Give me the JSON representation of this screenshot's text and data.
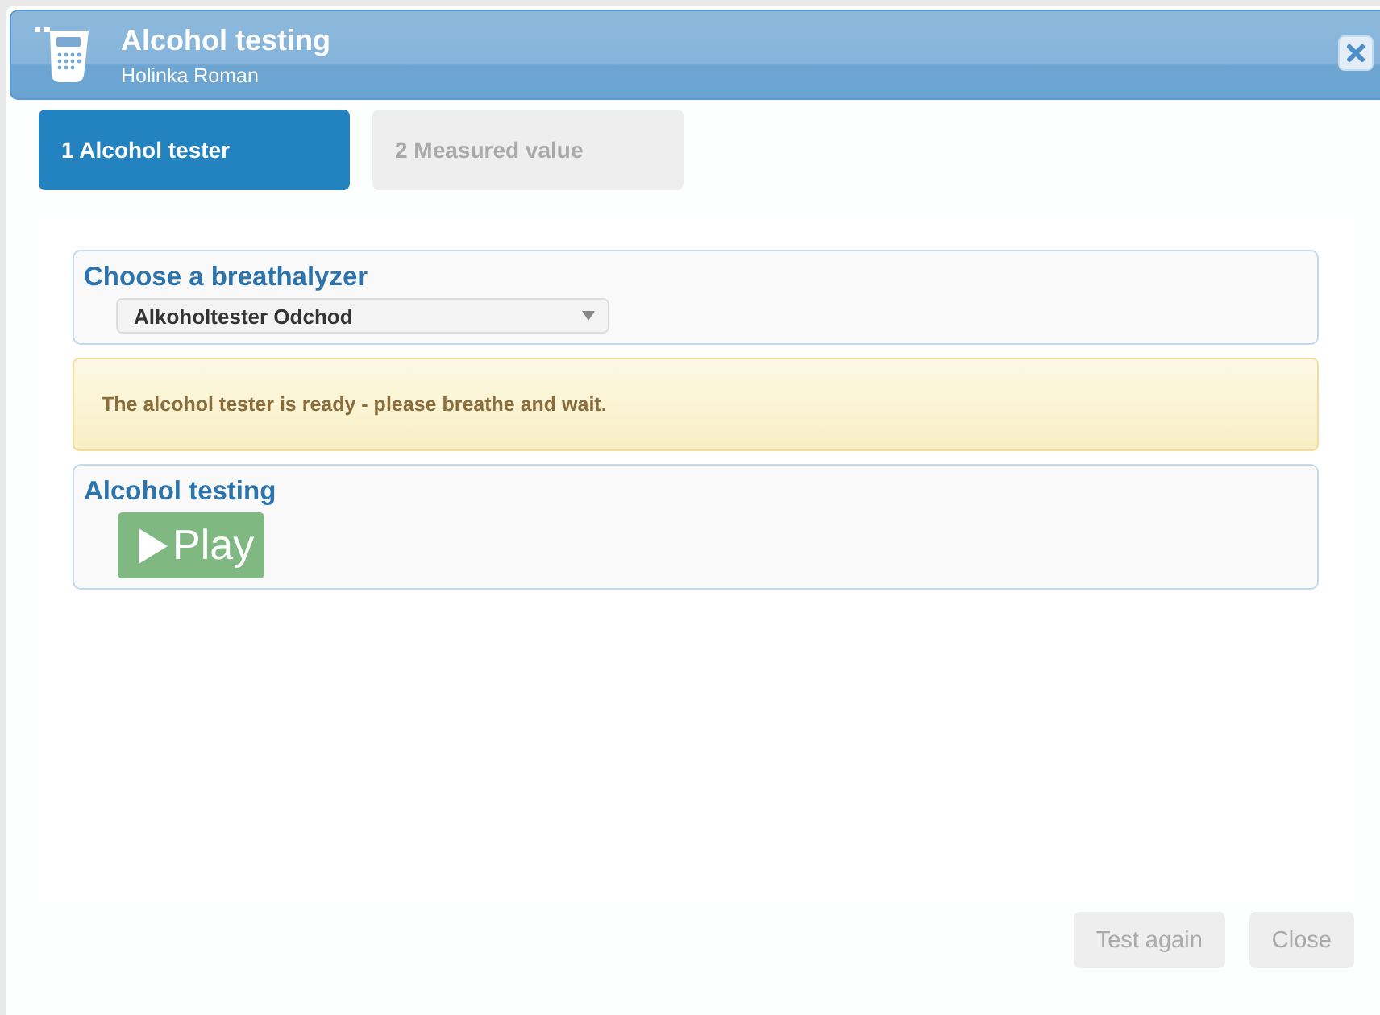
{
  "dialog": {
    "title": "Alcohol testing",
    "subtitle": "Holinka Roman"
  },
  "steps": [
    {
      "label": "1 Alcohol tester",
      "selected": true
    },
    {
      "label": "2 Measured value",
      "selected": false
    }
  ],
  "breathalyzer": {
    "heading": "Choose a breathalyzer",
    "value": "Alkoholtester Odchod"
  },
  "alert": {
    "text": "The alcohol tester is ready - please breathe and wait."
  },
  "testing": {
    "heading": "Alcohol testing",
    "play_label": "Play"
  },
  "buttons": [
    {
      "label": "Test again",
      "disabled": true
    },
    {
      "label": "Close",
      "disabled": true
    }
  ]
}
